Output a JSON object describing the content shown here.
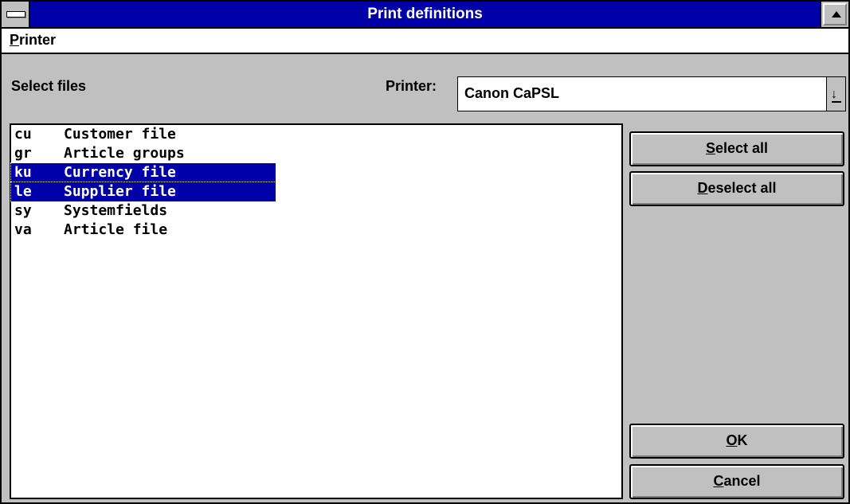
{
  "window": {
    "title": "Print definitions"
  },
  "menu": {
    "printer_label": "Printer"
  },
  "labels": {
    "select_files": "Select files",
    "printer": "Printer:"
  },
  "printer_select": {
    "value": "Canon CaPSL"
  },
  "file_list": [
    {
      "code": "cu",
      "name": "Customer file",
      "selected": false
    },
    {
      "code": "gr",
      "name": "Article groups",
      "selected": false
    },
    {
      "code": "ku",
      "name": "Currency file",
      "selected": true
    },
    {
      "code": "le",
      "name": "Supplier file",
      "selected": true
    },
    {
      "code": "sy",
      "name": "Systemfields",
      "selected": false
    },
    {
      "code": "va",
      "name": "Article file",
      "selected": false
    }
  ],
  "buttons": {
    "select_all": "Select all",
    "deselect_all": "Deselect all",
    "ok": "OK",
    "cancel": "Cancel"
  },
  "colors": {
    "title_bar": "#0000a8",
    "selection": "#0000a8",
    "face": "#c0c0c0"
  }
}
